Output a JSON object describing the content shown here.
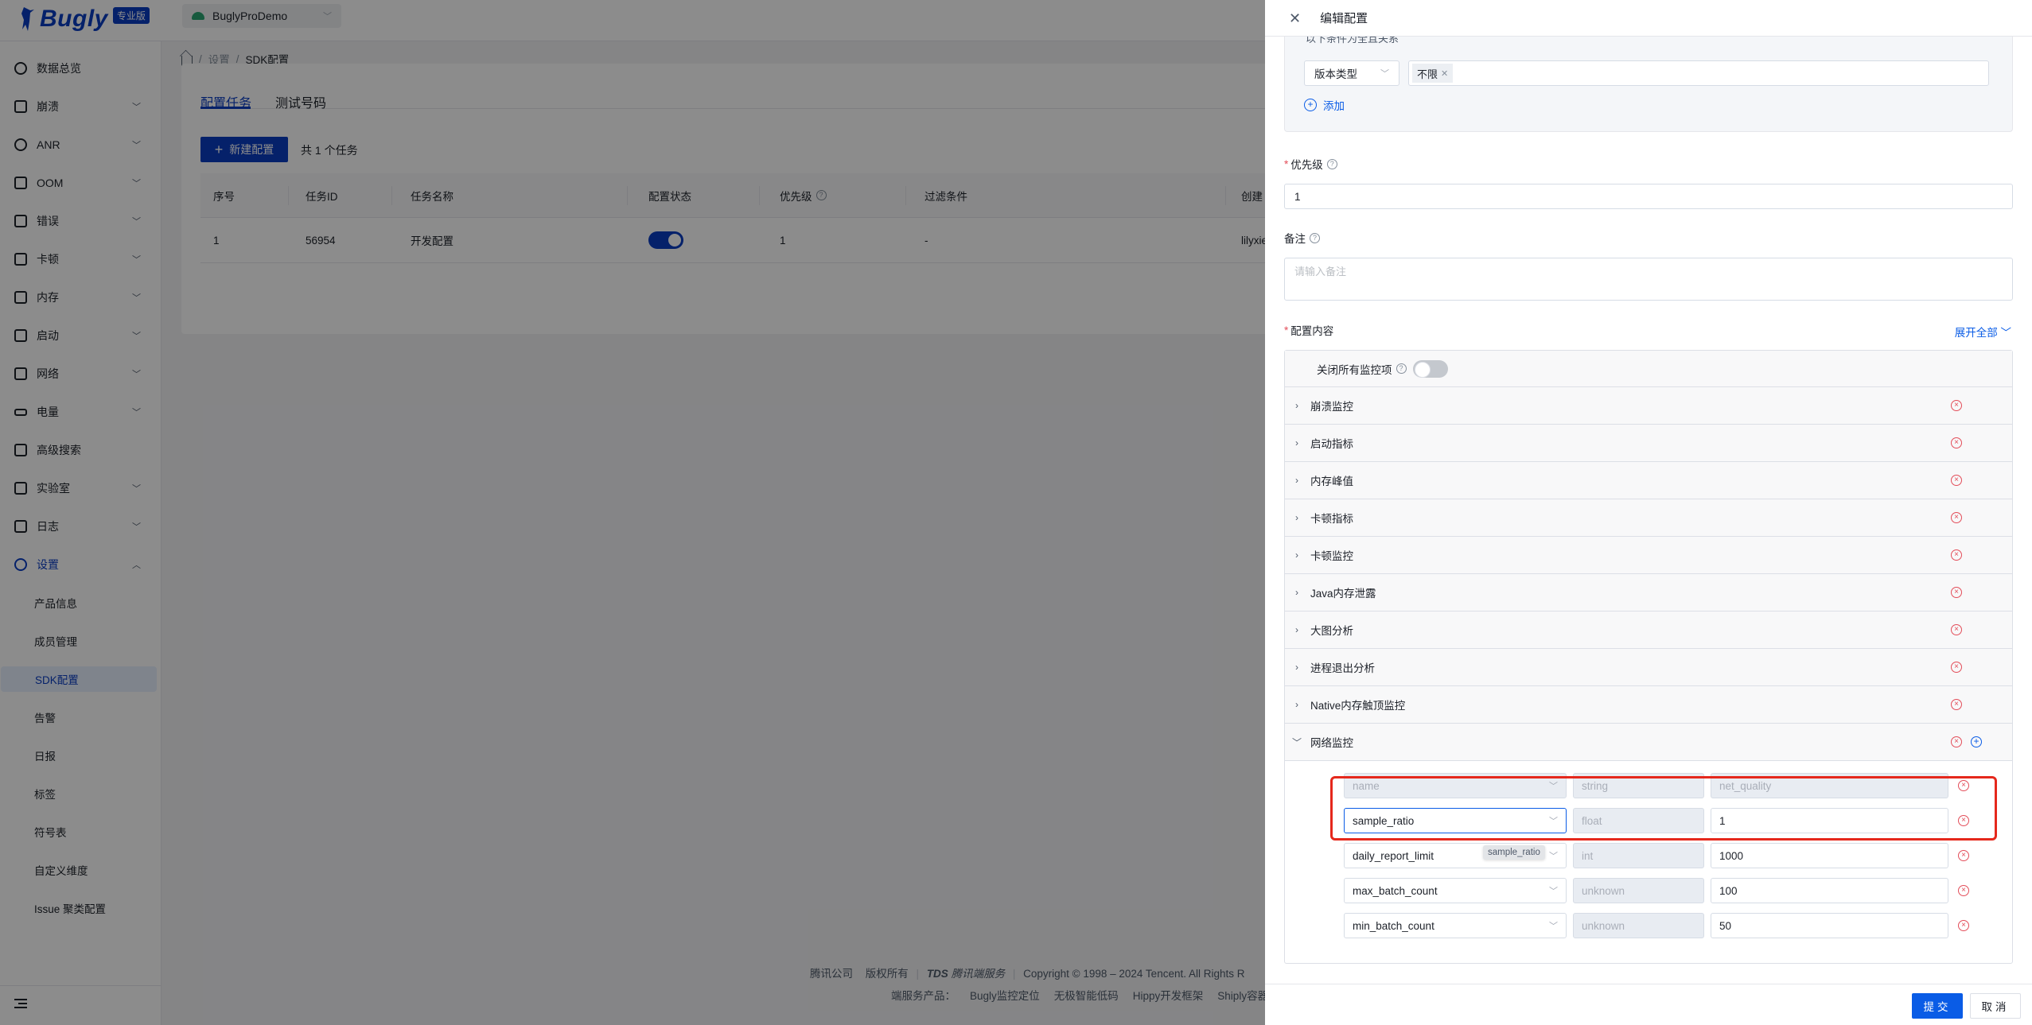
{
  "header": {
    "logo_text": "Bugly",
    "logo_badge": "专业版",
    "app_name": "BuglyProDemo"
  },
  "sidebar": {
    "items": [
      {
        "label": "数据总览",
        "icon": "pie-chart-icon",
        "expandable": false
      },
      {
        "label": "崩溃",
        "icon": "crash-icon",
        "expandable": true
      },
      {
        "label": "ANR",
        "icon": "anr-icon",
        "expandable": true
      },
      {
        "label": "OOM",
        "icon": "oom-folder-icon",
        "expandable": true
      },
      {
        "label": "错误",
        "icon": "error-icon",
        "expandable": true
      },
      {
        "label": "卡顿",
        "icon": "lag-monitor-icon",
        "expandable": true
      },
      {
        "label": "内存",
        "icon": "memory-icon",
        "expandable": true
      },
      {
        "label": "启动",
        "icon": "launch-icon",
        "expandable": true
      },
      {
        "label": "网络",
        "icon": "network-icon",
        "expandable": true
      },
      {
        "label": "电量",
        "icon": "battery-icon",
        "expandable": true
      },
      {
        "label": "高级搜索",
        "icon": "advanced-search-icon",
        "expandable": false
      },
      {
        "label": "实验室",
        "icon": "lab-icon",
        "expandable": true
      },
      {
        "label": "日志",
        "icon": "log-icon",
        "expandable": true
      },
      {
        "label": "设置",
        "icon": "settings-icon",
        "expandable": true,
        "active": true
      }
    ],
    "settings_children": [
      "产品信息",
      "成员管理",
      "SDK配置",
      "告警",
      "日报",
      "标签",
      "符号表",
      "自定义维度",
      "Issue 聚类配置"
    ],
    "active_child": "SDK配置"
  },
  "breadcrumb": [
    "设置",
    "SDK配置"
  ],
  "tabs": [
    {
      "label": "配置任务",
      "active": true
    },
    {
      "label": "测试号码",
      "active": false
    }
  ],
  "toolbar": {
    "new_button": "新建配置",
    "count_text": "共 1 个任务"
  },
  "table": {
    "columns": [
      "序号",
      "任务ID",
      "任务名称",
      "配置状态",
      "优先级",
      "过滤条件",
      "创建"
    ],
    "rows": [
      {
        "index": "1",
        "task_id": "56954",
        "name": "开发配置",
        "enabled": true,
        "priority": "1",
        "filter": "-",
        "creator": "lilyxie"
      }
    ]
  },
  "footer": {
    "company": "腾讯公司",
    "rights": "版权所有",
    "tds": "TDS",
    "tds_name": "腾讯端服务",
    "copyright": "Copyright © 1998 – 2024 Tencent. All Rights R",
    "products_label": "端服务产品：",
    "products": [
      "Bugly监控定位",
      "无极智能低码",
      "Hippy开发框架",
      "Shiply容器"
    ]
  },
  "drawer": {
    "title": "编辑配置",
    "conditions": {
      "hint": "以下条件为全且关系",
      "field": "版本类型",
      "tags": [
        "不限"
      ],
      "add_label": "添加"
    },
    "priority": {
      "label": "优先级",
      "required": true,
      "value": "1"
    },
    "remark": {
      "label": "备注",
      "placeholder": "请输入备注",
      "value": ""
    },
    "content": {
      "label": "配置内容",
      "required": true,
      "expand_all": "展开全部",
      "close_all_label": "关闭所有监控项",
      "close_all_on": false,
      "sections": [
        {
          "label": "崩溃监控",
          "expanded": false
        },
        {
          "label": "启动指标",
          "expanded": false
        },
        {
          "label": "内存峰值",
          "expanded": false
        },
        {
          "label": "卡顿指标",
          "expanded": false
        },
        {
          "label": "卡顿监控",
          "expanded": false
        },
        {
          "label": "Java内存泄露",
          "expanded": false
        },
        {
          "label": "大图分析",
          "expanded": false
        },
        {
          "label": "进程退出分析",
          "expanded": false
        },
        {
          "label": "Native内存触顶监控",
          "expanded": false
        },
        {
          "label": "网络监控",
          "expanded": true
        }
      ],
      "network_params": [
        {
          "name": "name",
          "type": "string",
          "value": "net_quality",
          "disabled": true
        },
        {
          "name": "sample_ratio",
          "type": "float",
          "value": "1",
          "focused": true
        },
        {
          "name": "daily_report_limit",
          "type": "int",
          "value": "1000"
        },
        {
          "name": "max_batch_count",
          "type": "unknown",
          "value": "100"
        },
        {
          "name": "min_batch_count",
          "type": "unknown",
          "value": "50"
        }
      ],
      "tooltip": "sample_ratio"
    },
    "submit_label": "提交",
    "cancel_label": "取消"
  },
  "colors": {
    "brand": "#0a3cc2",
    "link": "#0a5ce6",
    "danger": "#e34d59",
    "highlight": "#e5281c"
  }
}
